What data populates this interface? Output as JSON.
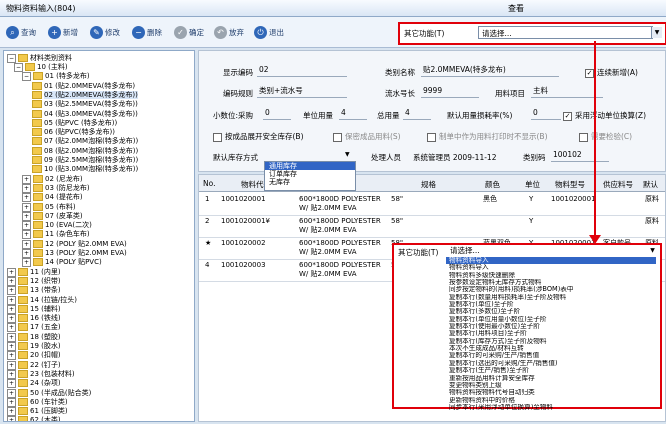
{
  "window": {
    "title": "物料资料输入(804)",
    "view_label": "查看"
  },
  "toolbar": {
    "query": "查询",
    "add": "新增",
    "edit": "修改",
    "delete": "删除",
    "confirm": "确定",
    "discard": "放弃",
    "exit": "退出"
  },
  "other_func_top": {
    "label": "其它功能(T)",
    "value": "请选择..."
  },
  "tree": {
    "root": "材料类别资料",
    "nodes": [
      "10 (主料)",
      "01 (特多龙布)",
      "01 (贴2.0MMEVA(特多龙布)",
      "02 (贴2.0MMEVA(特多龙布))",
      "03 (贴2.5MMEVA(特多龙布))",
      "04 (贴3.0MMEVA(特多龙布))",
      "05 (贴PVC (特多龙布))",
      "06 (贴PVC(特多龙布))",
      "07 (贴2.0MM泡棉(特多龙布))",
      "08 (贴2.0MM泡棉(特多龙布))",
      "09 (贴2.5MM泡棉(特多龙布))",
      "10 (贴3.0MM泡棉(特多龙布))",
      "02 (尼龙布)",
      "03 (防尼龙布)",
      "04 (提花布)",
      "05 (布料)",
      "07 (皮革类)",
      "10 (EVA(二次)",
      "11 (杂色车布)",
      "12 (POLY 贴2.0MM EVA)",
      "13 (POLY 贴2.0MM EVA)",
      "14 (POLY 贴PVC)",
      "11 (内里)",
      "12 (织带)",
      "13 (带条)",
      "14 (拉链/拉头)",
      "15 (辅料)",
      "16 (铁线)",
      "17 (五金)",
      "18 (塑胶)",
      "19 (胶水)",
      "20 (扣帽)",
      "22 (钉子)",
      "23 (包装材料)",
      "24 (杂项)",
      "50 (半成品(贴合类)",
      "60 (车针类)",
      "61 (压脚类)",
      "62 (木类)"
    ]
  },
  "form": {
    "display_code_label": "显示编码",
    "display_code": "02",
    "category_name_label": "类别名称",
    "category_name": "贴2.0MMEVA(特多龙布)",
    "continuous_add_label": "连续新增(A)",
    "code_rule_label": "编码规则",
    "code_rule": "类别+流水号",
    "serial_len_label": "流水号长",
    "serial_len": "9999",
    "material_item_label": "用料项目",
    "material_item": "主料",
    "decimals_label": "小数位:采购",
    "decimals": "0",
    "unit_price_label": "单位用量",
    "unit_price": "4",
    "total_label": "总用量",
    "total": "4",
    "default_loss_label": "默认用量损耗率(%)",
    "default_loss": "0",
    "float_unit_label": "采用浮动单位换算(Z)",
    "safety_stock_label": "按成品展开安全库存(B)",
    "semi_label": "保密成品用料(S)",
    "no_print_label": "制单中作为用料打印时不显示(B)",
    "qc_label": "需要检验(C)",
    "default_stock_label": "默认库存方式",
    "handler_label": "处理人员",
    "handler": "系统管理员 2009-11-12",
    "category_code_label": "类别码",
    "category_code": "100102"
  },
  "stock_options": [
    "通用库存",
    "订单库存",
    "无库存"
  ],
  "grid": {
    "headers": [
      "No.",
      "物料代码",
      "规格",
      "颜色",
      "单位",
      "物料型号",
      "供应料号",
      "默认"
    ],
    "rows": [
      {
        "no": "1",
        "code": "1001020001",
        "name": "600*1800D POLYESTER W/ 贴2.0MM EVA",
        "size": "58\"",
        "color": "黑色",
        "unit": "Y",
        "model": "1001020001",
        "supplier": "",
        "default": "原料"
      },
      {
        "no": "2",
        "code": "1001020001¥",
        "name": "600*1800D POLYESTER W/ 贴2.0MM EVA",
        "size": "58\"",
        "color": "",
        "unit": "Y",
        "model": "",
        "supplier": "",
        "default": "原料"
      },
      {
        "no": "★",
        "code": "1001020002",
        "name": "600*1800D POLYESTER W/ 贴2.0MM EVA",
        "size": "58\"",
        "color": "蓝黑双色",
        "unit": "Y",
        "model": "1001020001",
        "supplier": "客户款号",
        "default": "原料"
      },
      {
        "no": "4",
        "code": "1001020003",
        "name": "600*1800D POLYESTER W/ 贴2.0MM EVA",
        "size": "58\"",
        "color": "",
        "unit": "",
        "model": "",
        "supplier": "",
        "default": ""
      }
    ]
  },
  "other_func_grid": {
    "label": "其它功能(T)",
    "value": "请选择..."
  },
  "menu": [
    "物料资料导入",
    "物料资料导入",
    "物料资料多级快速删除",
    "按参数设定物料无库存方式物料",
    "同步按定物料的(用料)损耗率(涉BOM)表中",
    "复制本行(数量用料损耗率)至子阶及物料",
    "复制本行(单位)至子阶",
    "复制本行(多数位)至子阶",
    "复制本行(单位用量小数位)至子阶",
    "复制本行(使用最小数位)至子阶",
    "复制本行(用料项目)至子阶",
    "复制本行(库存方式)至子阶及物料",
    "本次不生成成品/材料互转",
    "复制本行的可采购/生产/销售值",
    "复制本行(选出的可采购/生产/销售值)",
    "复制本行(生产/销售)至子阶",
    "重新按用品用料计算安全库存",
    "变更物料类别上级",
    "物料资料按物料代号自动归类",
    "更新物料资料中的价格",
    "同步本行(采用浮动单位换算)至物料"
  ]
}
